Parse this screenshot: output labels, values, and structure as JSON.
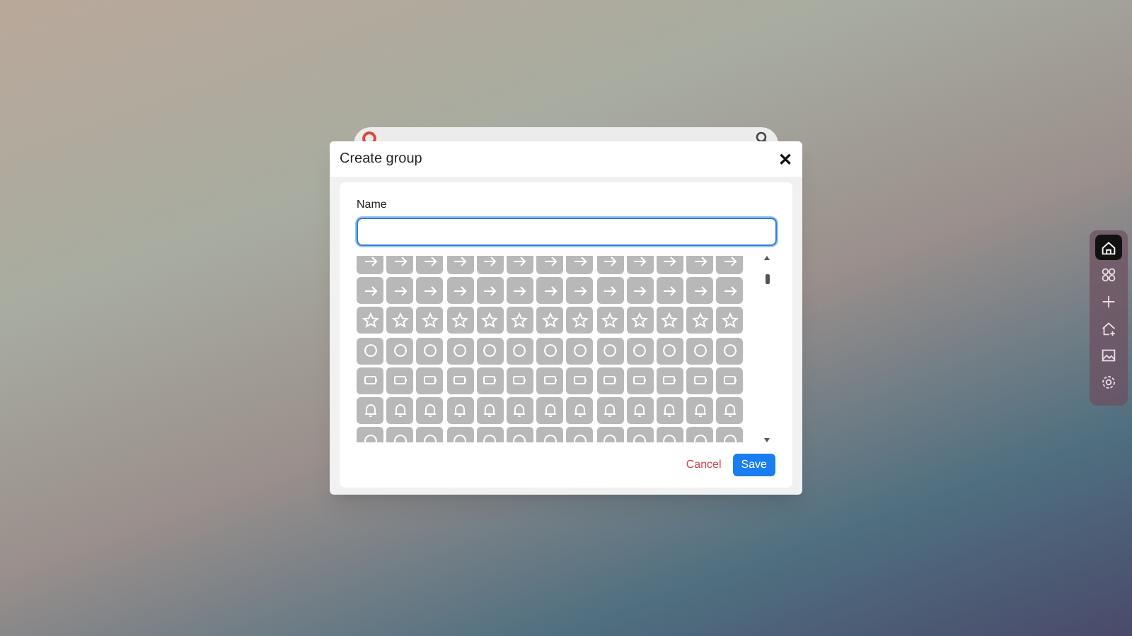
{
  "dialog": {
    "title": "Create group",
    "close": "✕",
    "name_field": {
      "label": "Name",
      "focused": true
    },
    "buttons": [
      {
        "label": "Cancel",
        "kind": "text"
      },
      {
        "label": "Save",
        "kind": "primary"
      }
    ]
  },
  "dock": {
    "items": [
      {
        "selected": true
      },
      {
        "selected": false
      },
      {
        "selected": false
      },
      {
        "selected": false
      },
      {
        "selected": false
      },
      {
        "selected": false
      }
    ]
  }
}
